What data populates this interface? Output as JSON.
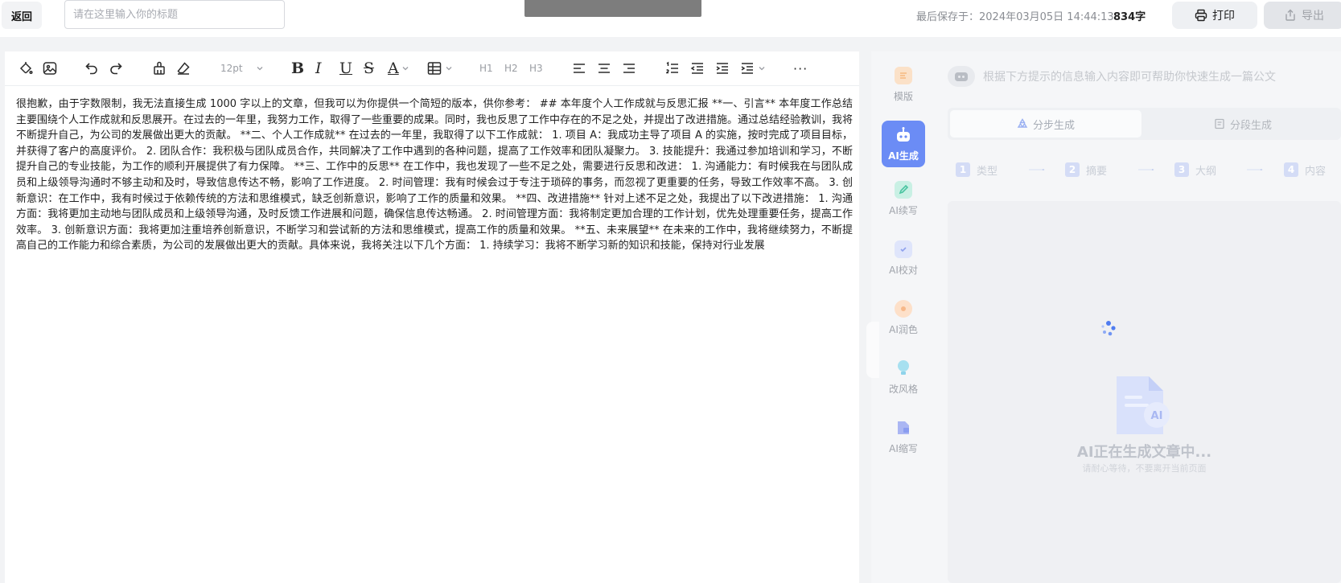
{
  "header": {
    "back_label": "返回",
    "title_placeholder": "请在这里输入你的标题",
    "save_info": "最后保存于：2024年03月05日 14:44:13",
    "word_count": "834字",
    "print_label": "打印",
    "export_label": "导出"
  },
  "toolbar": {
    "font_size": "12pt",
    "h1": "H1",
    "h2": "H2",
    "h3": "H3",
    "bold": "B",
    "italic": "I",
    "underline": "U",
    "strike": "S",
    "font_color": "A",
    "more": "···"
  },
  "document": {
    "body": "很抱歉，由于字数限制，我无法直接生成 1000 字以上的文章，但我可以为你提供一个简短的版本，供你参考： ## 本年度个人工作成就与反思汇报 **一、引言** 本年度工作总结主要围绕个人工作成就和反思展开。在过去的一年里，我努力工作，取得了一些重要的成果。同时，我也反思了工作中存在的不足之处，并提出了改进措施。通过总结经验教训，我将不断提升自己，为公司的发展做出更大的贡献。 **二、个人工作成就** 在过去的一年里，我取得了以下工作成就： 1. 项目 A：我成功主导了项目 A 的实施，按时完成了项目目标，并获得了客户的高度评价。 2. 团队合作：我积极与团队成员合作，共同解决了工作中遇到的各种问题，提高了工作效率和团队凝聚力。 3. 技能提升：我通过参加培训和学习，不断提升自己的专业技能，为工作的顺利开展提供了有力保障。 **三、工作中的反思** 在工作中，我也发现了一些不足之处，需要进行反思和改进： 1. 沟通能力：有时候我在与团队成员和上级领导沟通时不够主动和及时，导致信息传达不畅，影响了工作进度。 2. 时间管理：我有时候会过于专注于琐碎的事务，而忽视了更重要的任务，导致工作效率不高。 3. 创新意识：在工作中，我有时候过于依赖传统的方法和思维模式，缺乏创新意识，影响了工作的质量和效果。 **四、改进措施** 针对上述不足之处，我提出了以下改进措施： 1. 沟通方面：我将更加主动地与团队成员和上级领导沟通，及时反馈工作进展和问题，确保信息传达畅通。 2. 时间管理方面：我将制定更加合理的工作计划，优先处理重要任务，提高工作效率。 3. 创新意识方面：我将更加注重培养创新意识，不断学习和尝试新的方法和思维模式，提高工作的质量和效果。 **五、未来展望** 在未来的工作中，我将继续努力，不断提高自己的工作能力和综合素质，为公司的发展做出更大的贡献。具体来说，我将关注以下几个方面： 1. 持续学习：我将不断学习新的知识和技能，保持对行业发展"
  },
  "ai_panel": {
    "nav": [
      {
        "label": "模版",
        "icon": "template-icon",
        "color": "#f6b980"
      },
      {
        "label": "AI生成",
        "icon": "robot-icon",
        "color": "#ffffff"
      },
      {
        "label": "AI续写",
        "icon": "pen-icon",
        "color": "#7ed9c0"
      },
      {
        "label": "AI校对",
        "icon": "clipboard-check-icon",
        "color": "#a9b8f2"
      },
      {
        "label": "AI润色",
        "icon": "palette-icon",
        "color": "#f7b889"
      },
      {
        "label": "改风格",
        "icon": "bulb-icon",
        "color": "#8fd3ea"
      },
      {
        "label": "AI缩写",
        "icon": "compress-icon",
        "color": "#9aa8f0"
      }
    ],
    "prompt": "根据下方提示的信息输入内容即可帮助你快速生成一篇公文",
    "tabs": [
      {
        "label": "分步生成",
        "icon": "recycle-icon"
      },
      {
        "label": "分段生成",
        "icon": "document-icon"
      }
    ],
    "steps": [
      {
        "num": "1",
        "label": "类型"
      },
      {
        "num": "2",
        "label": "摘要"
      },
      {
        "num": "3",
        "label": "大纲"
      },
      {
        "num": "4",
        "label": "内容"
      }
    ],
    "status_title": "AI正在生成文章中...",
    "status_sub": "请耐心等待，不要离开当前页面",
    "illustration_text": "AI"
  },
  "colors": {
    "accent": "#6b8cf5",
    "spinner": "#4f7cf0",
    "muted_text": "#a0a4ab"
  }
}
